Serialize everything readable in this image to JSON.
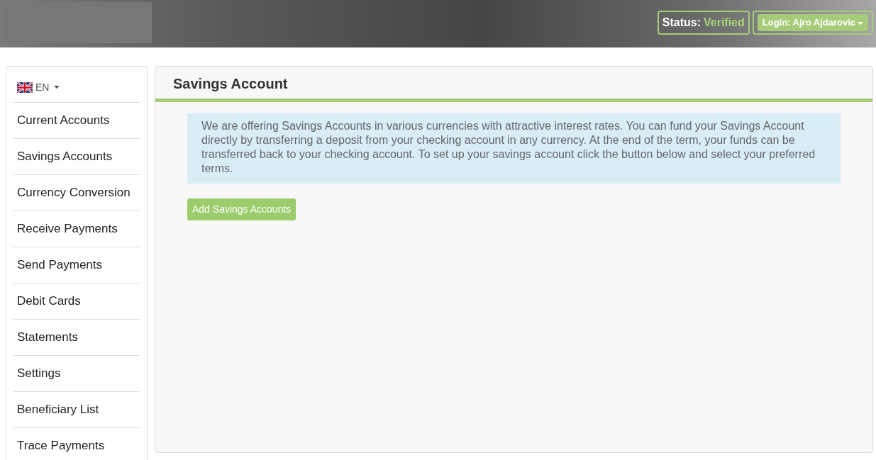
{
  "header": {
    "status_label": "Status:",
    "status_value": "Verified",
    "login": "Login: Ajro Ajdarovic"
  },
  "sidebar": {
    "language": "EN",
    "items": [
      {
        "label": "Current Accounts"
      },
      {
        "label": "Savings Accounts"
      },
      {
        "label": "Currency Conversion"
      },
      {
        "label": "Receive Payments"
      },
      {
        "label": "Send Payments"
      },
      {
        "label": "Debit Cards"
      },
      {
        "label": "Statements"
      },
      {
        "label": "Settings"
      },
      {
        "label": "Beneficiary List"
      },
      {
        "label": "Trace Payments"
      }
    ]
  },
  "panel": {
    "title": "Savings Account",
    "info": "We are offering Savings Accounts in various currencies with attractive interest rates. You can fund your Savings Account directly by transferring a deposit from your checking account in any currency. At the end of the term, your funds can be transferred back to your checking account. To set up your savings account click the button below and select your preferred terms.",
    "button": "Add Savings Accounts"
  }
}
